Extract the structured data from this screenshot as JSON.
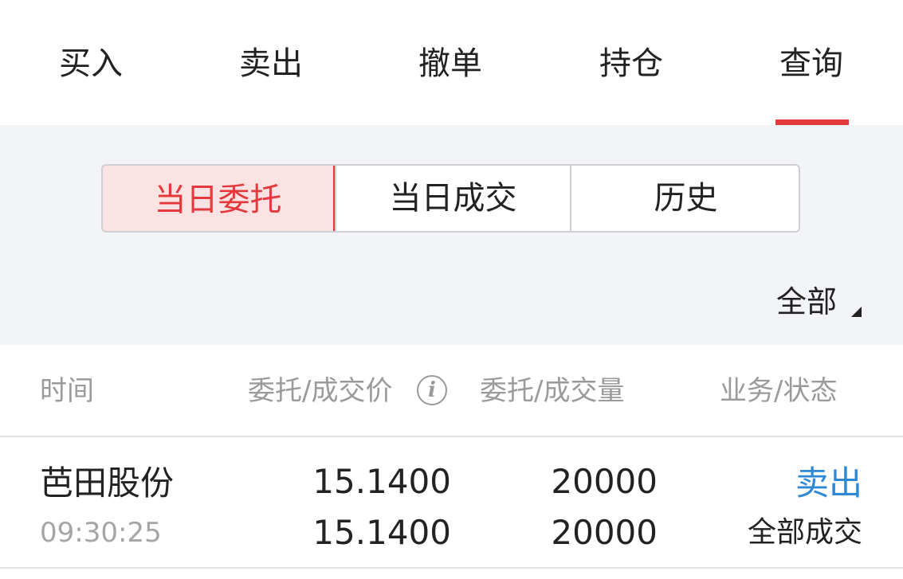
{
  "top_tabs": [
    {
      "label": "买入"
    },
    {
      "label": "卖出"
    },
    {
      "label": "撤单"
    },
    {
      "label": "持仓"
    },
    {
      "label": "查询"
    }
  ],
  "active_tab": "查询",
  "segments": [
    {
      "label": "当日委托"
    },
    {
      "label": "当日成交"
    },
    {
      "label": "历史"
    }
  ],
  "active_segment": "当日委托",
  "filter": {
    "selected": "全部"
  },
  "table": {
    "headers": [
      "时间",
      "委托/成交价",
      "委托/成交量",
      "业务/状态"
    ],
    "rows": [
      {
        "name": "芭田股份",
        "time": "09:30:25",
        "order_price": "15.1400",
        "deal_price": "15.1400",
        "order_qty": "20000",
        "deal_qty": "20000",
        "business": "卖出",
        "status": "全部成交"
      }
    ]
  },
  "icons": {
    "info": "i"
  },
  "colors": {
    "accent": "#e4393c",
    "active_segment_bg": "#fbe3e3",
    "business_sell": "#2f88d6",
    "filter_bg": "#f3f4f7"
  }
}
